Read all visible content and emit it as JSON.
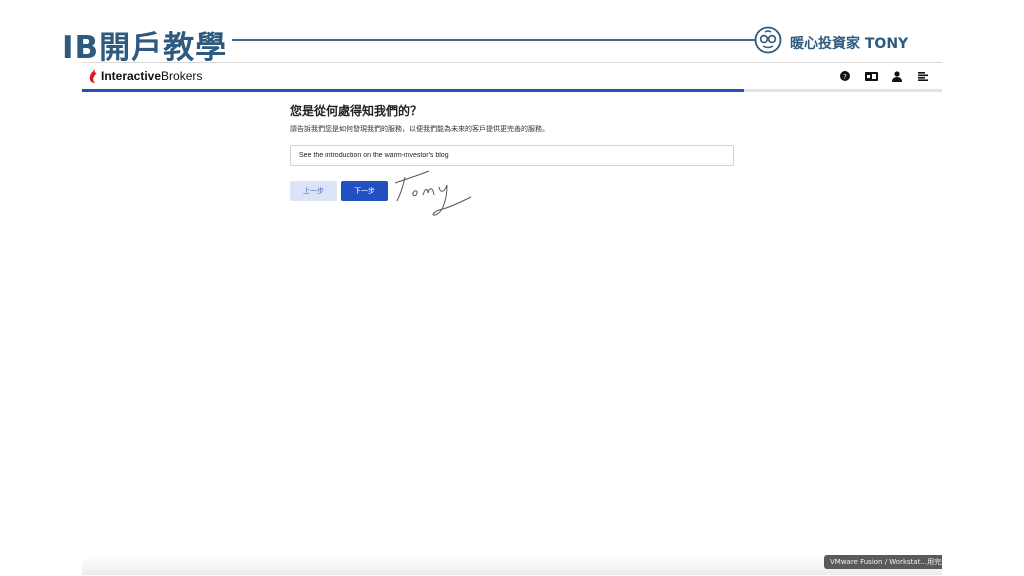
{
  "slide": {
    "title": "IB開戶教學",
    "brand_name": "暖心投資家 TONY"
  },
  "app": {
    "logo_bold": "Interactive",
    "logo_regular": "Brokers",
    "header_icons": [
      "help-icon",
      "language-icon",
      "user-icon",
      "menu-icon"
    ],
    "progress": 0.77,
    "colors": {
      "accent": "#2350c0",
      "progress": "#2a4fb3",
      "slide_title": "#2d5a7e"
    }
  },
  "form": {
    "question": "您是從何處得知我們的？",
    "subtitle": "請告訴我們您是如何發現我們的服務，以便我們能為未來的客戶提供更完善的服務。",
    "answer_value": "See the introduction on the warm-investor's blog",
    "back_label": "上一步",
    "next_label": "下一步"
  },
  "taskbar": {
    "tooltip": "VMware Fusion / Workstat...用完全"
  }
}
